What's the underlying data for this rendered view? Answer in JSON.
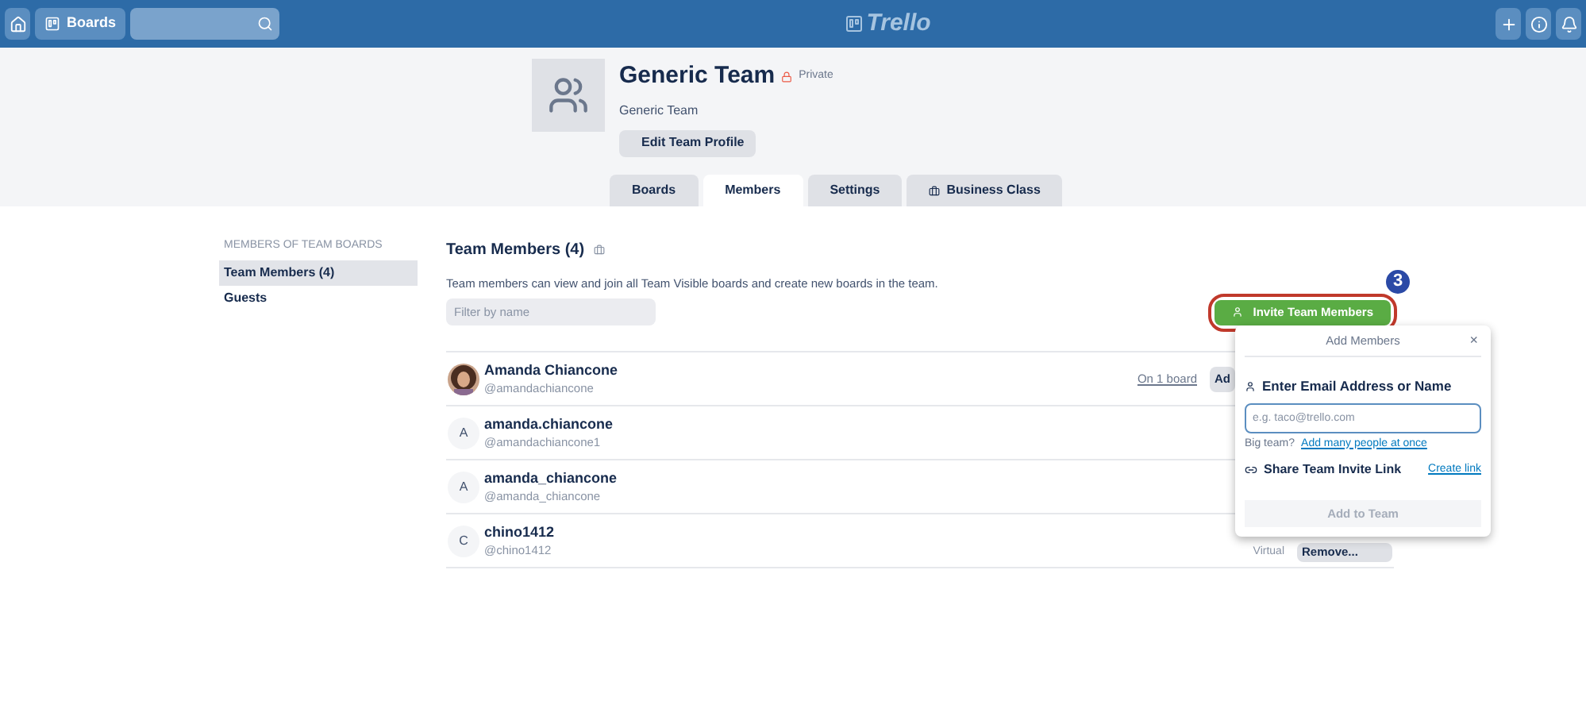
{
  "top_bar": {
    "boards_button": "Boards",
    "logo": "Trello"
  },
  "team": {
    "name": "Generic Team",
    "privacy": "Private",
    "description": "Generic Team",
    "edit_button": "Edit Team Profile"
  },
  "tabs": [
    {
      "label": "Boards",
      "selected": false
    },
    {
      "label": "Members",
      "selected": true
    },
    {
      "label": "Settings",
      "selected": false
    },
    {
      "label": "Business Class",
      "selected": false,
      "kind": "icon"
    }
  ],
  "sidebar": {
    "heading": "MEMBERS OF TEAM BOARDS",
    "items": [
      {
        "label": "Team Members (4)",
        "selected": true
      },
      {
        "label": "Guests",
        "selected": false
      }
    ]
  },
  "members": {
    "title": "Team Members (4)",
    "description": "Team members can view and join all Team Visible boards and create new boards in the team.",
    "filter": {
      "placeholder": "Filter by name"
    },
    "invite_button": "Invite Team Members",
    "step_badge": "3",
    "rows": [
      {
        "name": "Amanda Chiancone",
        "username": "@amandachiancone",
        "boards_link": "On 1 board",
        "action": "Ad"
      },
      {
        "name": "amanda.chiancone",
        "username": "@amandachiancone1",
        "avatar": {
          "kind": "initial",
          "letter": "A"
        }
      },
      {
        "name": "amanda_chiancone",
        "username": "@amanda_chiancone",
        "avatar": {
          "kind": "initial",
          "letter": "A"
        }
      },
      {
        "name": "chino1412",
        "username": "@chino1412",
        "avatar": {
          "kind": "initial",
          "letter": "C"
        },
        "type_label": "Virtual",
        "action": "Remove..."
      }
    ]
  },
  "popup": {
    "title": "Add Members",
    "close": "×",
    "label": "Enter Email Address or Name",
    "placeholder": "e.g. taco@trello.com",
    "big_team": "Big team?",
    "bulk_link": "Add many people at once",
    "share_label": "Share Team Invite Link",
    "create_link": "Create link",
    "submit": "Add to Team"
  }
}
